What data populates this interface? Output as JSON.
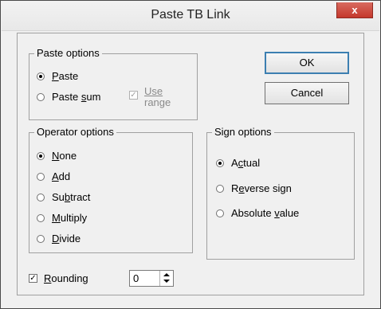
{
  "window": {
    "title": "Paste TB Link",
    "close_label": "x"
  },
  "paste_options": {
    "legend": "Paste options",
    "options": [
      {
        "pre": "",
        "u": "P",
        "post": "aste",
        "selected": true
      },
      {
        "pre": "Paste ",
        "u": "s",
        "post": "um",
        "selected": false
      }
    ],
    "use_range": {
      "line1": "Use",
      "line2": "range",
      "checked": true,
      "enabled": false
    }
  },
  "buttons": {
    "ok": "OK",
    "cancel": "Cancel"
  },
  "operator_options": {
    "legend": "Operator options",
    "options": [
      {
        "pre": "",
        "u": "N",
        "post": "one",
        "selected": true
      },
      {
        "pre": "",
        "u": "A",
        "post": "dd",
        "selected": false
      },
      {
        "pre": "Su",
        "u": "b",
        "post": "tract",
        "selected": false
      },
      {
        "pre": "",
        "u": "M",
        "post": "ultiply",
        "selected": false
      },
      {
        "pre": "",
        "u": "D",
        "post": "ivide",
        "selected": false
      }
    ]
  },
  "sign_options": {
    "legend": "Sign options",
    "options": [
      {
        "pre": "A",
        "u": "c",
        "post": "tual",
        "selected": true
      },
      {
        "pre": "R",
        "u": "e",
        "post": "verse sign",
        "selected": false
      },
      {
        "pre": "Absolute ",
        "u": "v",
        "post": "alue",
        "selected": false
      }
    ]
  },
  "rounding": {
    "pre": "",
    "u": "R",
    "post": "ounding",
    "checked": true,
    "value": "0"
  }
}
